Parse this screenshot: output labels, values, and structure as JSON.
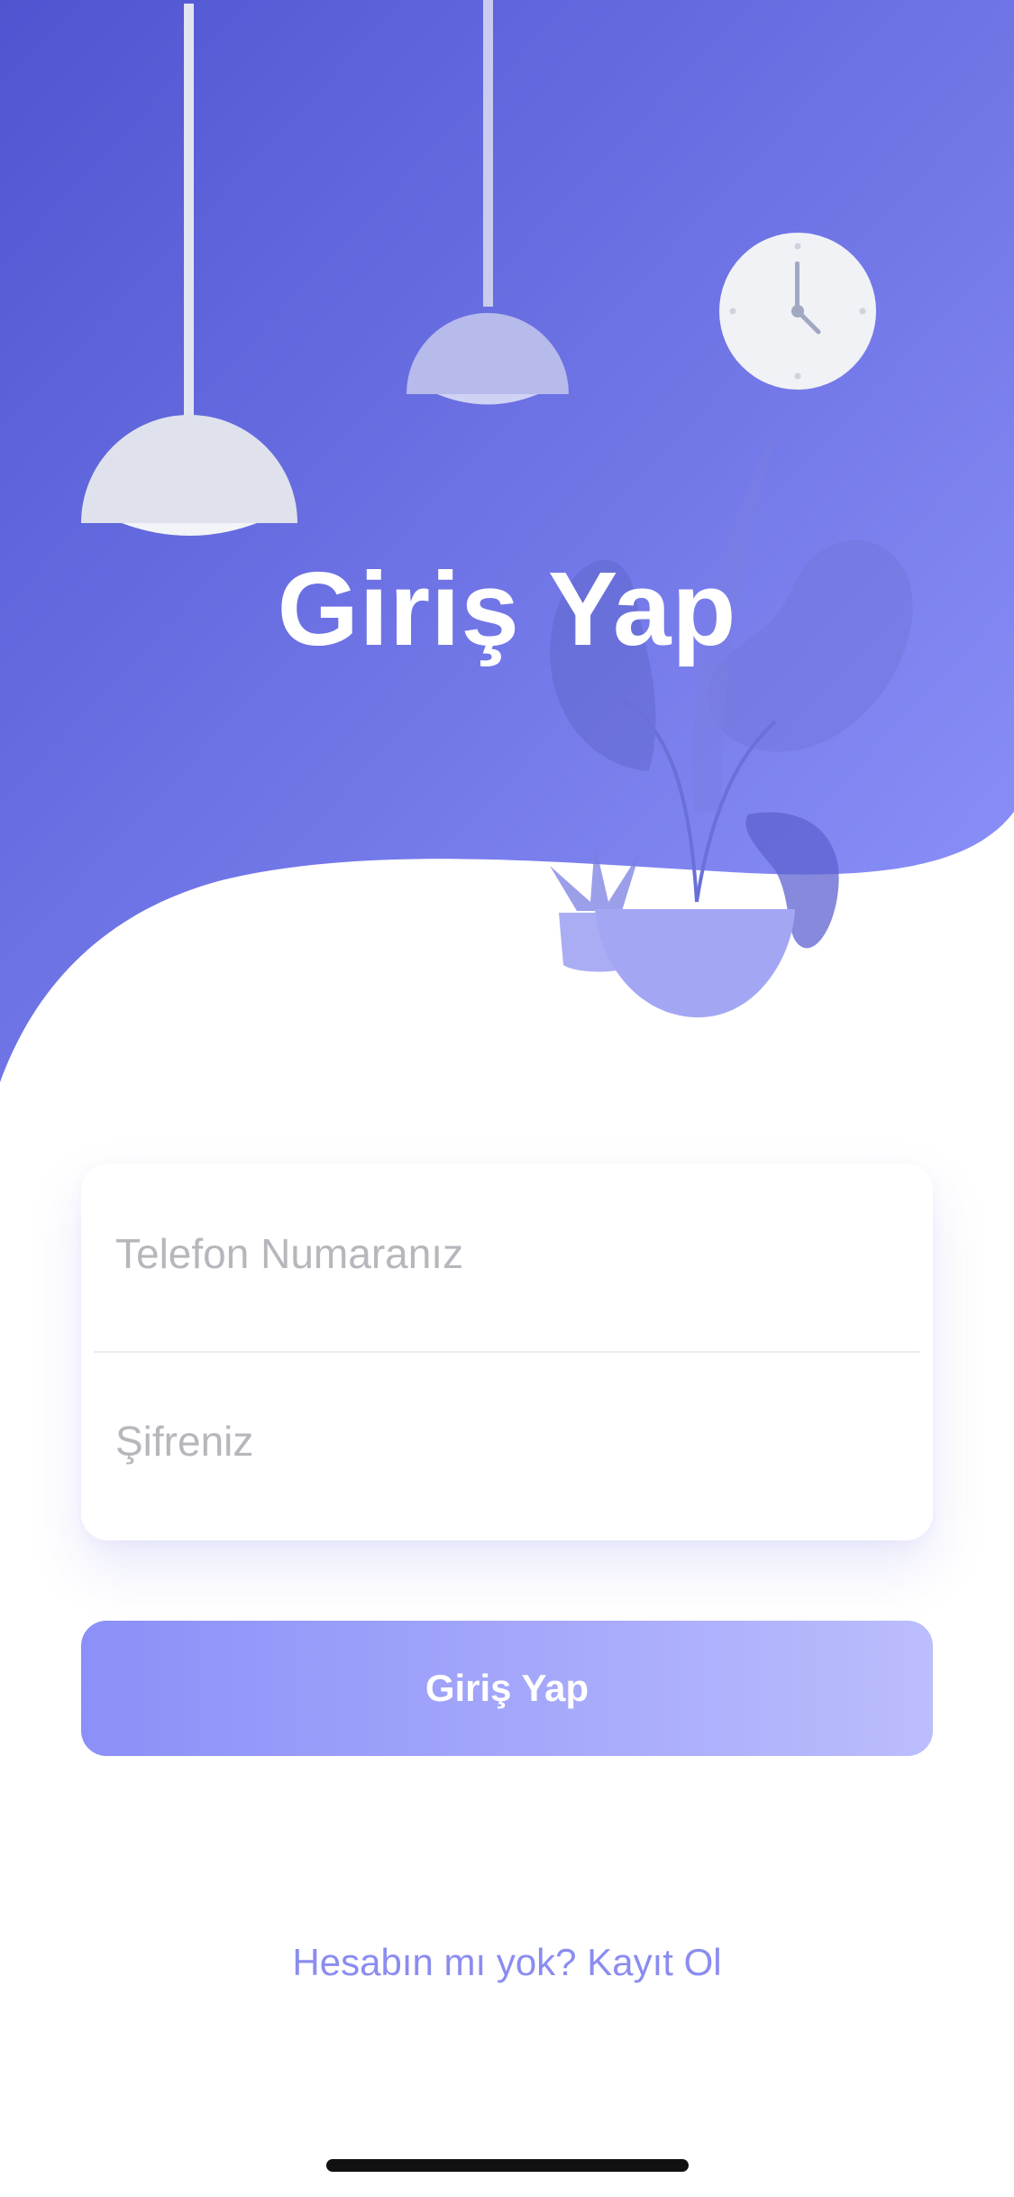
{
  "screen": {
    "title": "Giriş Yap"
  },
  "form": {
    "phone_placeholder": "Telefon Numaranız",
    "password_placeholder": "Şifreniz",
    "submit_label": "Giriş Yap"
  },
  "footer": {
    "signup_link": "Hesabın mı yok? Kayıt Ol"
  },
  "icons": [
    "pendant-lamp-icon",
    "wall-clock-icon",
    "plant-pot-icon"
  ],
  "colors": {
    "gradient_start": "#4f55d0",
    "gradient_end": "#8f94fb",
    "button_start": "#8b8ff8",
    "button_end": "#bbbdfd",
    "link": "#8b8cf0",
    "placeholder": "#b6b6bc"
  }
}
